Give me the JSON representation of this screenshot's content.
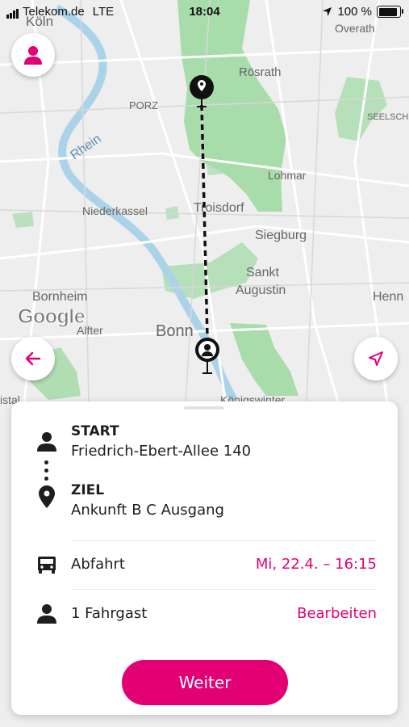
{
  "status_bar": {
    "carrier": "Telekom.de",
    "network": "LTE",
    "time": "18:04",
    "battery": "100 %",
    "battery_level": 1.0
  },
  "map": {
    "labels": [
      {
        "text": "Köln"
      },
      {
        "text": "Overath"
      },
      {
        "text": "Rösrath"
      },
      {
        "text": "PORZ"
      },
      {
        "text": "SEELSCH"
      },
      {
        "text": "Rhein"
      },
      {
        "text": "Lohmar"
      },
      {
        "text": "Niederkassel"
      },
      {
        "text": "Troisdorf"
      },
      {
        "text": "Siegburg"
      },
      {
        "text": "Sankt"
      },
      {
        "text": "Augustin"
      },
      {
        "text": "Bornheim"
      },
      {
        "text": "Henn"
      },
      {
        "text": "Alfter"
      },
      {
        "text": "Bonn"
      },
      {
        "text": "istal"
      },
      {
        "text": "Königswinter"
      }
    ],
    "attribution": "Google",
    "pin_icon": "destination-pin-icon",
    "start_icon": "start-person-pin-icon"
  },
  "route": {
    "start_title": "START",
    "start_address": "Friedrich-Ebert-Allee 140",
    "destination_title": "ZIEL",
    "destination_address": "Ankunft B C Ausgang",
    "departure_label": "Abfahrt",
    "departure_value": "Mi, 22.4. – 16:15",
    "passengers_label": "1 Fahrgast",
    "edit_label": "Bearbeiten",
    "continue_label": "Weiter"
  },
  "colors": {
    "accent": "#e20074",
    "text": "#1e1e1e",
    "map_green": "#a8dcab"
  }
}
